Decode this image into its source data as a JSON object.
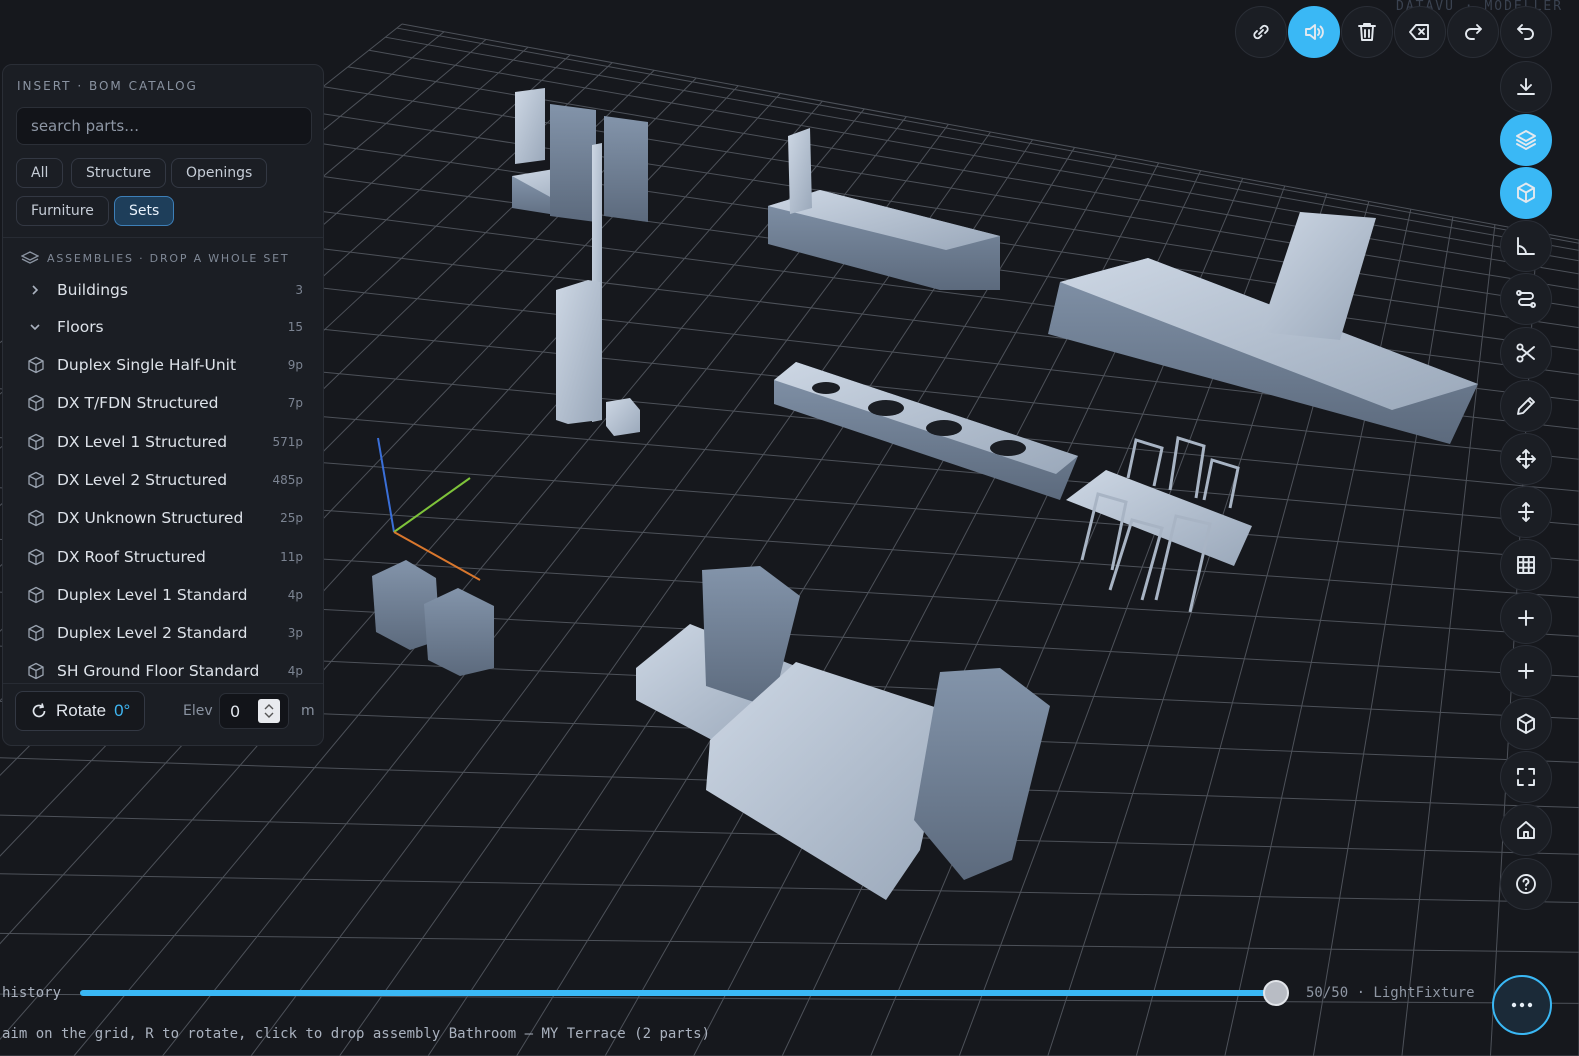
{
  "app": {
    "watermark": "DATAVU · MODELLER"
  },
  "catalog": {
    "title": "INSERT · BOM CATALOG",
    "search_placeholder": "search parts…",
    "filters": [
      "All",
      "Structure",
      "Openings",
      "Furniture",
      "Sets"
    ],
    "active_filter": "Sets",
    "assemblies_label": "ASSEMBLIES · DROP A WHOLE SET",
    "groups": [
      {
        "label": "Buildings",
        "count": "3",
        "expanded": false
      },
      {
        "label": "Floors",
        "count": "15",
        "expanded": true
      }
    ],
    "items": [
      {
        "label": "Duplex Single Half-Unit",
        "count": "9p"
      },
      {
        "label": "DX T/FDN Structured",
        "count": "7p"
      },
      {
        "label": "DX Level 1 Structured",
        "count": "571p"
      },
      {
        "label": "DX Level 2 Structured",
        "count": "485p"
      },
      {
        "label": "DX Unknown Structured",
        "count": "25p"
      },
      {
        "label": "DX Roof Structured",
        "count": "11p"
      },
      {
        "label": "Duplex Level 1 Standard",
        "count": "4p"
      },
      {
        "label": "Duplex Level 2 Standard",
        "count": "3p"
      },
      {
        "label": "SH Ground Floor Standard",
        "count": "4p"
      }
    ],
    "rotate": {
      "label": "Rotate",
      "value": "0°"
    },
    "elevation": {
      "label": "Elev",
      "value": "0",
      "unit": "m"
    }
  },
  "toolbar": {
    "top": [
      "link-icon",
      "speaker-icon",
      "trash-icon",
      "backspace-icon",
      "redo-icon",
      "undo-icon"
    ],
    "top_active": [
      "speaker-icon"
    ],
    "side": [
      "download-icon",
      "layers-icon",
      "box-icon",
      "angle-icon",
      "route-icon",
      "scissors-icon",
      "pencil-icon",
      "move-icon",
      "vertical-move-icon",
      "grid-icon",
      "plus-icon",
      "plus-icon",
      "cube-icon",
      "fullscreen-icon",
      "home-icon",
      "help-icon"
    ],
    "side_active": [
      "layers-icon",
      "box-icon"
    ]
  },
  "history": {
    "label": "history",
    "current": 50,
    "total": 50,
    "count_text": "50/50 · LightFixture"
  },
  "status": {
    "text": "aim on the grid, R to rotate, click to drop assembly Bathroom — MY Terrace (2 parts)"
  },
  "colors": {
    "accent": "#3ab8f5",
    "background": "#16181d",
    "panel": "#1b1e24"
  }
}
